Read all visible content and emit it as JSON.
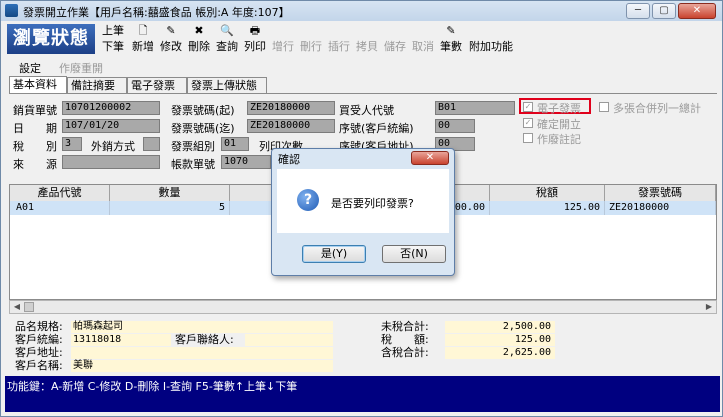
{
  "window": {
    "title": "發票開立作業【用戶名稱:囍盛食品 帳別:A 年度:107】",
    "buttons": {
      "minimize": "─",
      "maximize": "▢",
      "close": "✕"
    }
  },
  "toolbar": {
    "state_label": "瀏覽狀態",
    "buttons": [
      {
        "top": "上筆",
        "bottom": "下筆"
      },
      {
        "icon": "🗋",
        "label": "新增"
      },
      {
        "icon": "✎",
        "label": "修改"
      },
      {
        "icon": "✖",
        "label": "刪除"
      },
      {
        "icon": "🔍",
        "label": "查詢"
      },
      {
        "icon": "🖶",
        "label": "列印"
      },
      {
        "icon": "",
        "label": "增行"
      },
      {
        "icon": "",
        "label": "刪行"
      },
      {
        "icon": "",
        "label": "插行"
      },
      {
        "icon": "",
        "label": "拷貝"
      },
      {
        "icon": "",
        "label": "儲存"
      },
      {
        "icon": "",
        "label": "取消"
      },
      {
        "icon": "✎",
        "label": "筆數"
      },
      {
        "icon": "",
        "label": "附加功能"
      }
    ]
  },
  "menu": {
    "settings": "設定",
    "void_reopen": "作廢重開"
  },
  "tabs": [
    "基本資料",
    "備註摘要",
    "電子發票",
    "發票上傳狀態"
  ],
  "form": {
    "sales_no_label": "銷貨單號",
    "sales_no": "10701200002",
    "date_label": "日　　期",
    "date": "107/01/20",
    "tax_label": "稅　　別",
    "tax": "3",
    "tax_method_label": "外銷方式",
    "tax_method": "",
    "source_label": "來　　源",
    "source": "",
    "inv_start_label": "發票號碼(起)",
    "inv_start": "ZE20180000",
    "inv_end_label": "發票號碼(迄)",
    "inv_end": "ZE20180000",
    "inv_group_label": "發票組別",
    "inv_group": "01",
    "account_no_label": "帳款單號",
    "account_no": "1070",
    "buyer_label": "買受人代號",
    "buyer": "B01",
    "seq_label": "序號(客戶統編)",
    "seq": "00",
    "print_count_label": "列印次數",
    "print_count": "0",
    "addr_seq_label": "序號(客戶地址)",
    "addr_seq": "00",
    "e_invoice_label": "電子發票",
    "confirm_label": "確定開立",
    "void_mark_label": "作廢註記",
    "merge_label": "多張合併列一總計"
  },
  "grid": {
    "headers": [
      "產品代號",
      "數量",
      "",
      "稅額",
      "發票號碼"
    ],
    "rows": [
      {
        "code": "A01",
        "qty": "5",
        "amount": "00.00",
        "tax": "125.00",
        "invoice": "ZE20180000"
      }
    ]
  },
  "info": {
    "product_label": "品名規格:",
    "product": "帕瑪森起司",
    "tax_id_label": "客戶統編:",
    "tax_id": "13118018",
    "contact_label": "客戶聯絡人:",
    "contact": "",
    "addr_label": "客戶地址:",
    "addr": "",
    "name_label": "客戶名稱:",
    "name": "美聯",
    "pretax_label": "未稅合計:",
    "pretax": "2,500.00",
    "taxamt_label": "稅　　額:",
    "taxamt": "125.00",
    "total_label": "含稅合計:",
    "total": "2,625.00"
  },
  "function_keys": "功能鍵：A-新增 C-修改 D-刪除 I-查詢 F5-筆數↑上筆↓下筆",
  "dialog": {
    "title": "確認",
    "message": "是否要列印發票?",
    "yes": "是(Y)",
    "no": "否(N)",
    "close": "✕"
  },
  "colors": {
    "state_bg": "#1c3f86",
    "fkey_bg": "#000080",
    "highlight": "#e0001b",
    "row_sel": "#cfe3f7"
  }
}
